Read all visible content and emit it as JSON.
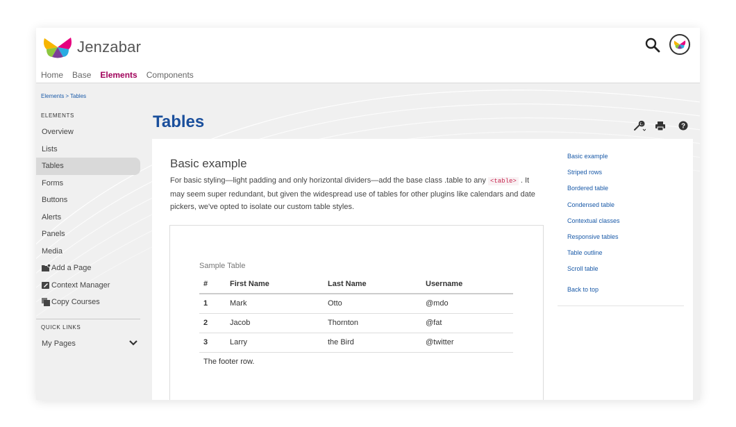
{
  "brand": {
    "name": "Jenzabar"
  },
  "topnav": [
    {
      "label": "Home",
      "active": false
    },
    {
      "label": "Base",
      "active": false
    },
    {
      "label": "Elements",
      "active": true
    },
    {
      "label": "Components",
      "active": false
    }
  ],
  "colors": {
    "accent": "#a0005a",
    "title_blue": "#1a4f9c",
    "link_blue": "#1a5aa8"
  },
  "breadcrumb": {
    "parent": "Elements",
    "separator": ">",
    "current": "Tables"
  },
  "sidebar": {
    "heading": "ELEMENTS",
    "items": [
      {
        "label": "Overview",
        "icon": ""
      },
      {
        "label": "Lists",
        "icon": ""
      },
      {
        "label": "Tables",
        "icon": "",
        "active": true
      },
      {
        "label": "Forms",
        "icon": ""
      },
      {
        "label": "Buttons",
        "icon": ""
      },
      {
        "label": "Alerts",
        "icon": ""
      },
      {
        "label": "Panels",
        "icon": ""
      },
      {
        "label": "Media",
        "icon": ""
      },
      {
        "label": "Add a Page",
        "icon": "folder-add-icon"
      },
      {
        "label": "Context Manager",
        "icon": "edit-icon"
      },
      {
        "label": "Copy Courses",
        "icon": "copy-icon"
      }
    ],
    "quick_links_heading": "QUICK LINKS",
    "my_pages": "My Pages"
  },
  "page": {
    "title": "Tables"
  },
  "tools": [
    "wrench-icon",
    "print-icon",
    "help-icon"
  ],
  "section": {
    "title": "Basic example",
    "desc_before": "For basic styling—light padding and only horizontal dividers—add the base class .table to any ",
    "desc_code": "<table>",
    "desc_after": " . It may seem super redundant, but given the widespread use of tables for other plugins like calendars and date pickers, we've opted to isolate our custom table styles."
  },
  "table": {
    "caption": "Sample Table",
    "headers": [
      "#",
      "First Name",
      "Last Name",
      "Username"
    ],
    "rows": [
      [
        "1",
        "Mark",
        "Otto",
        "@mdo"
      ],
      [
        "2",
        "Jacob",
        "Thornton",
        "@fat"
      ],
      [
        "3",
        "Larry",
        "the Bird",
        "@twitter"
      ]
    ],
    "footer": "The footer row."
  },
  "toc": {
    "links": [
      "Basic example",
      "Striped rows",
      "Bordered table",
      "Condensed table",
      "Contextual classes",
      "Responsive tables",
      "Table outline",
      "Scroll table"
    ],
    "back_to_top": "Back to top"
  }
}
